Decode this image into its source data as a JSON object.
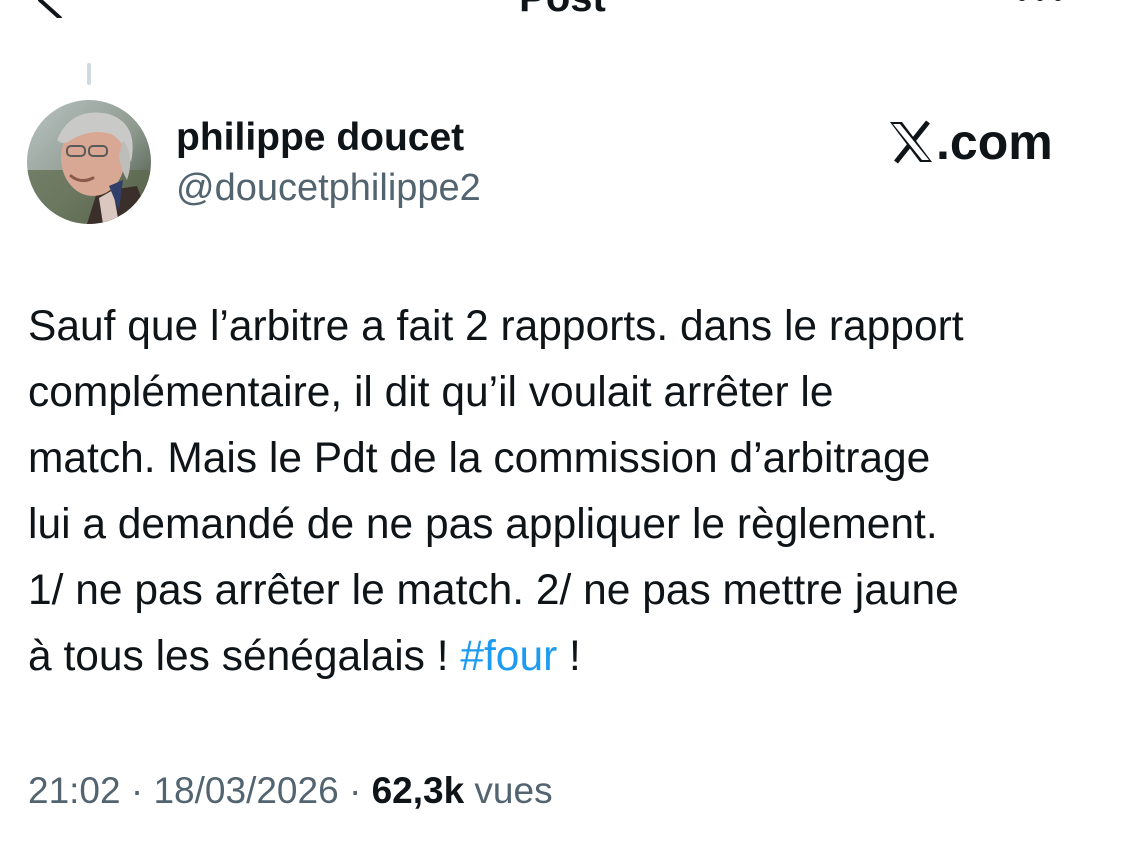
{
  "header": {
    "title": "Post"
  },
  "author": {
    "display_name": "philippe doucet",
    "handle": "@doucetphilippe2"
  },
  "brand": {
    "label": ".com",
    "icon": "x-logo-icon"
  },
  "tweet": {
    "text_before_hashtag": "Sauf que l’arbitre a fait 2 rapports. dans le rapport\ncomplémentaire, il dit qu’il voulait arrêter le\nmatch. Mais le Pdt de la commission d’arbitrage\nlui a demandé de ne pas appliquer le règlement.\n1/ ne pas arrêter le match. 2/ ne pas mettre jaune\nà tous les sénégalais ! ",
    "hashtag": "#four",
    "text_after_hashtag": " !"
  },
  "meta": {
    "time": "21:02",
    "separator": " · ",
    "date": "18/03/2026",
    "views_count": "62,3k",
    "views_label": " vues"
  },
  "colors": {
    "text": "#0f1419",
    "secondary": "#536471",
    "link": "#1d9bf0"
  }
}
